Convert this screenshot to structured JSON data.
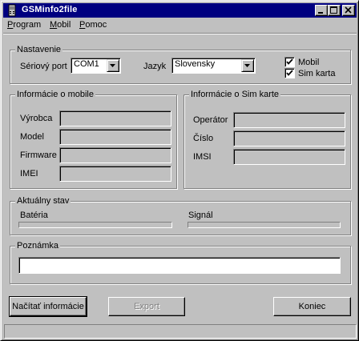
{
  "window": {
    "title": "GSMinfo2file"
  },
  "menu": [
    {
      "label": "Program",
      "mnemonic": "P",
      "rest": "rogram"
    },
    {
      "label": "Mobil",
      "mnemonic": "M",
      "rest": "obil"
    },
    {
      "label": "Pomoc",
      "mnemonic": "P",
      "rest": "omoc"
    }
  ],
  "settings": {
    "group_label": "Nastavenie",
    "port_label": "Sériový port",
    "port_value": "COM1",
    "language_label": "Jazyk",
    "language_value": "Slovensky",
    "checkboxes": [
      {
        "label": "Mobil",
        "checked": true
      },
      {
        "label": "Sim karta",
        "checked": true
      }
    ]
  },
  "mobile_info": {
    "group_label": "Informácie o mobile",
    "fields": [
      {
        "label": "Výrobca",
        "value": ""
      },
      {
        "label": "Model",
        "value": ""
      },
      {
        "label": "Firmware",
        "value": ""
      },
      {
        "label": "IMEI",
        "value": ""
      }
    ]
  },
  "sim_info": {
    "group_label": "Informácie o Sim karte",
    "fields": [
      {
        "label": "Operátor",
        "value": ""
      },
      {
        "label": "Číslo",
        "value": ""
      },
      {
        "label": "IMSI",
        "value": ""
      }
    ]
  },
  "status": {
    "group_label": "Aktuálny stav",
    "battery_label": "Batéria",
    "signal_label": "Signál"
  },
  "note": {
    "group_label": "Poznámka",
    "value": ""
  },
  "buttons": {
    "load": "Načítať informácie",
    "export": "Export",
    "quit": "Koniec"
  },
  "icons": {
    "app": "phone-app-icon",
    "minimize": "minimize-icon",
    "maximize": "maximize-icon",
    "close": "close-icon",
    "dropdown": "chevron-down-icon",
    "check": "checkmark-icon"
  }
}
